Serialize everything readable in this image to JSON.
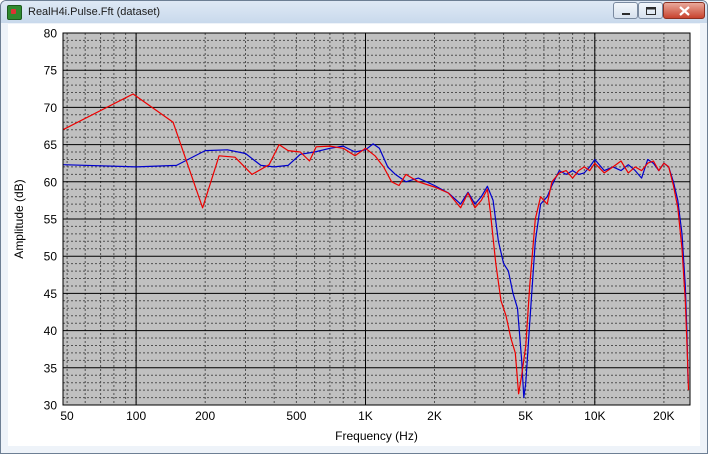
{
  "window": {
    "title": "RealH4i.Pulse.Fft (dataset)",
    "app_icon": "graph-app-icon",
    "controls": [
      "minimize-icon",
      "maximize-icon",
      "close-icon"
    ]
  },
  "chart_data": {
    "type": "line",
    "xlabel": "Frequency (Hz)",
    "ylabel": "Amplitude (dB)",
    "x_scale": "log",
    "xlim": [
      48,
      26000
    ],
    "ylim": [
      30,
      80
    ],
    "grid": true,
    "plot_background": "#c0c0c0",
    "x_ticks": [
      {
        "value": 50,
        "label": "50"
      },
      {
        "value": 100,
        "label": "100"
      },
      {
        "value": 200,
        "label": "200"
      },
      {
        "value": 500,
        "label": "500"
      },
      {
        "value": 1000,
        "label": "1K"
      },
      {
        "value": 2000,
        "label": "2K"
      },
      {
        "value": 5000,
        "label": "5K"
      },
      {
        "value": 10000,
        "label": "10K"
      },
      {
        "value": 20000,
        "label": "20K"
      }
    ],
    "y_ticks": [
      {
        "value": 30,
        "label": "30"
      },
      {
        "value": 35,
        "label": "35"
      },
      {
        "value": 40,
        "label": "40"
      },
      {
        "value": 45,
        "label": "45"
      },
      {
        "value": 50,
        "label": "50"
      },
      {
        "value": 55,
        "label": "55"
      },
      {
        "value": 60,
        "label": "60"
      },
      {
        "value": 65,
        "label": "65"
      },
      {
        "value": 70,
        "label": "70"
      },
      {
        "value": 75,
        "label": "75"
      },
      {
        "value": 80,
        "label": "80"
      }
    ],
    "series": [
      {
        "color": "#0000cc",
        "points": [
          [
            48,
            62.3
          ],
          [
            100,
            62
          ],
          [
            150,
            62.2
          ],
          [
            200,
            64.2
          ],
          [
            250,
            64.3
          ],
          [
            300,
            63.8
          ],
          [
            350,
            62.2
          ],
          [
            400,
            62
          ],
          [
            460,
            62.2
          ],
          [
            520,
            63.7
          ],
          [
            600,
            64
          ],
          [
            700,
            64.5
          ],
          [
            800,
            64.8
          ],
          [
            900,
            64
          ],
          [
            1000,
            64.3
          ],
          [
            1080,
            65.1
          ],
          [
            1150,
            64.5
          ],
          [
            1250,
            62
          ],
          [
            1350,
            61
          ],
          [
            1500,
            60
          ],
          [
            1700,
            60.5
          ],
          [
            2000,
            59.5
          ],
          [
            2300,
            58.5
          ],
          [
            2600,
            57
          ],
          [
            2800,
            58.6
          ],
          [
            3000,
            57
          ],
          [
            3200,
            58
          ],
          [
            3400,
            59.4
          ],
          [
            3600,
            57.5
          ],
          [
            3800,
            52
          ],
          [
            4000,
            49
          ],
          [
            4200,
            48
          ],
          [
            4400,
            45
          ],
          [
            4600,
            43
          ],
          [
            4800,
            36
          ],
          [
            4900,
            31
          ],
          [
            5000,
            33
          ],
          [
            5200,
            41
          ],
          [
            5500,
            52
          ],
          [
            5800,
            57
          ],
          [
            6200,
            58
          ],
          [
            6500,
            59.5
          ],
          [
            7000,
            61.5
          ],
          [
            7500,
            61
          ],
          [
            8000,
            61.5
          ],
          [
            8500,
            61
          ],
          [
            9000,
            61.2
          ],
          [
            9500,
            62
          ],
          [
            10000,
            63
          ],
          [
            11000,
            61.5
          ],
          [
            12000,
            62
          ],
          [
            13000,
            61.5
          ],
          [
            14000,
            62.3
          ],
          [
            15000,
            61.5
          ],
          [
            16000,
            60.5
          ],
          [
            17000,
            63
          ],
          [
            18000,
            62.5
          ],
          [
            19000,
            61.5
          ],
          [
            20000,
            62.5
          ],
          [
            21000,
            62
          ],
          [
            22000,
            60
          ],
          [
            23000,
            57.5
          ],
          [
            24000,
            53
          ],
          [
            24800,
            46
          ],
          [
            25200,
            40
          ],
          [
            25500,
            33
          ]
        ]
      },
      {
        "color": "#ee0000",
        "points": [
          [
            48,
            67
          ],
          [
            97,
            71.8
          ],
          [
            145,
            68
          ],
          [
            195,
            56.5
          ],
          [
            230,
            63.5
          ],
          [
            270,
            63.3
          ],
          [
            320,
            61
          ],
          [
            380,
            62.3
          ],
          [
            420,
            65
          ],
          [
            460,
            64.2
          ],
          [
            520,
            64
          ],
          [
            570,
            62.8
          ],
          [
            610,
            64.7
          ],
          [
            700,
            64.8
          ],
          [
            800,
            64.5
          ],
          [
            900,
            63.5
          ],
          [
            1000,
            64.5
          ],
          [
            1100,
            63.5
          ],
          [
            1200,
            62
          ],
          [
            1300,
            60
          ],
          [
            1400,
            59.5
          ],
          [
            1500,
            61
          ],
          [
            1700,
            60
          ],
          [
            2000,
            59.3
          ],
          [
            2300,
            58.5
          ],
          [
            2600,
            56.5
          ],
          [
            2800,
            58.5
          ],
          [
            3000,
            56.5
          ],
          [
            3200,
            57.5
          ],
          [
            3400,
            59
          ],
          [
            3500,
            56
          ],
          [
            3700,
            49
          ],
          [
            3900,
            44
          ],
          [
            4100,
            42
          ],
          [
            4300,
            39
          ],
          [
            4500,
            37
          ],
          [
            4650,
            31.5
          ],
          [
            4800,
            34
          ],
          [
            5000,
            38
          ],
          [
            5200,
            46
          ],
          [
            5500,
            55
          ],
          [
            5800,
            58
          ],
          [
            6200,
            57
          ],
          [
            6500,
            60
          ],
          [
            7000,
            61.2
          ],
          [
            7500,
            61.5
          ],
          [
            8000,
            60.5
          ],
          [
            8500,
            61.5
          ],
          [
            9000,
            62
          ],
          [
            9500,
            61.5
          ],
          [
            10000,
            62.5
          ],
          [
            11000,
            61.2
          ],
          [
            12000,
            62
          ],
          [
            13000,
            62.8
          ],
          [
            14000,
            61.2
          ],
          [
            15000,
            62
          ],
          [
            16000,
            61.5
          ],
          [
            17000,
            62.5
          ],
          [
            18000,
            62.8
          ],
          [
            19000,
            61.5
          ],
          [
            20000,
            62.5
          ],
          [
            21000,
            62
          ],
          [
            22000,
            59.5
          ],
          [
            23000,
            56.5
          ],
          [
            24000,
            51
          ],
          [
            24800,
            44
          ],
          [
            25300,
            37
          ],
          [
            25600,
            32
          ]
        ]
      }
    ]
  }
}
